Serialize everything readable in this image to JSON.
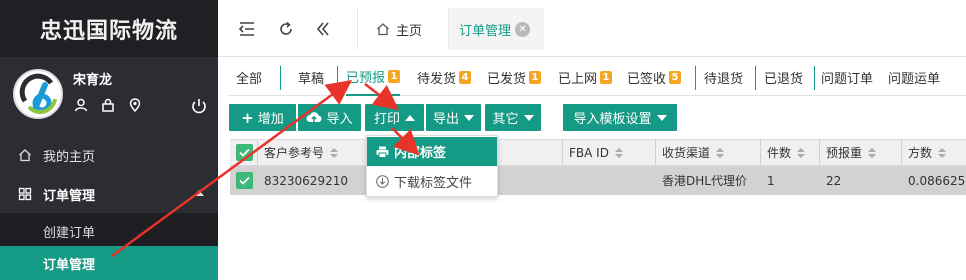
{
  "sidebar": {
    "brand": "忠迅国际物流",
    "username": "宋育龙",
    "nav": {
      "home": "我的主页",
      "order_management": "订单管理",
      "create_order": "创建订单",
      "order_manage_sub": "订单管理"
    }
  },
  "topbar": {
    "tabs": {
      "home": "主页",
      "order": "订单管理"
    }
  },
  "status_tabs": [
    {
      "label": "全部"
    },
    {
      "label": "草稿"
    },
    {
      "label": "已预报",
      "badge": "1",
      "active": true
    },
    {
      "label": "待发货",
      "badge": "4"
    },
    {
      "label": "已发货",
      "badge": "1"
    },
    {
      "label": "已上网",
      "badge": "1"
    },
    {
      "label": "已签收",
      "badge": "5"
    },
    {
      "label": "待退货"
    },
    {
      "label": "已退货"
    },
    {
      "label": "问题订单"
    },
    {
      "label": "问题运单"
    }
  ],
  "toolbar": {
    "add": "增加",
    "import": "导入",
    "print": "打印",
    "export": "导出",
    "other": "其它",
    "template": "导入模板设置"
  },
  "print_menu": {
    "inner_label": "内部标签",
    "download_label": "下载标签文件"
  },
  "table": {
    "headers": {
      "ref": "客户参考号",
      "fba": "FBA ID",
      "channel": "收货渠道",
      "pieces": "件数",
      "forecast_weight": "预报重",
      "cubic": "方数"
    },
    "rows": [
      {
        "ref": "83230629210",
        "fba": "",
        "channel": "香港DHL代理价",
        "pieces": "1",
        "forecast_weight": "22",
        "cubic": "0.086625"
      }
    ]
  },
  "colors": {
    "accent": "#159a85",
    "badge": "#f5a623",
    "sidebar": "#2b2d33",
    "arrow": "#e8332b"
  }
}
